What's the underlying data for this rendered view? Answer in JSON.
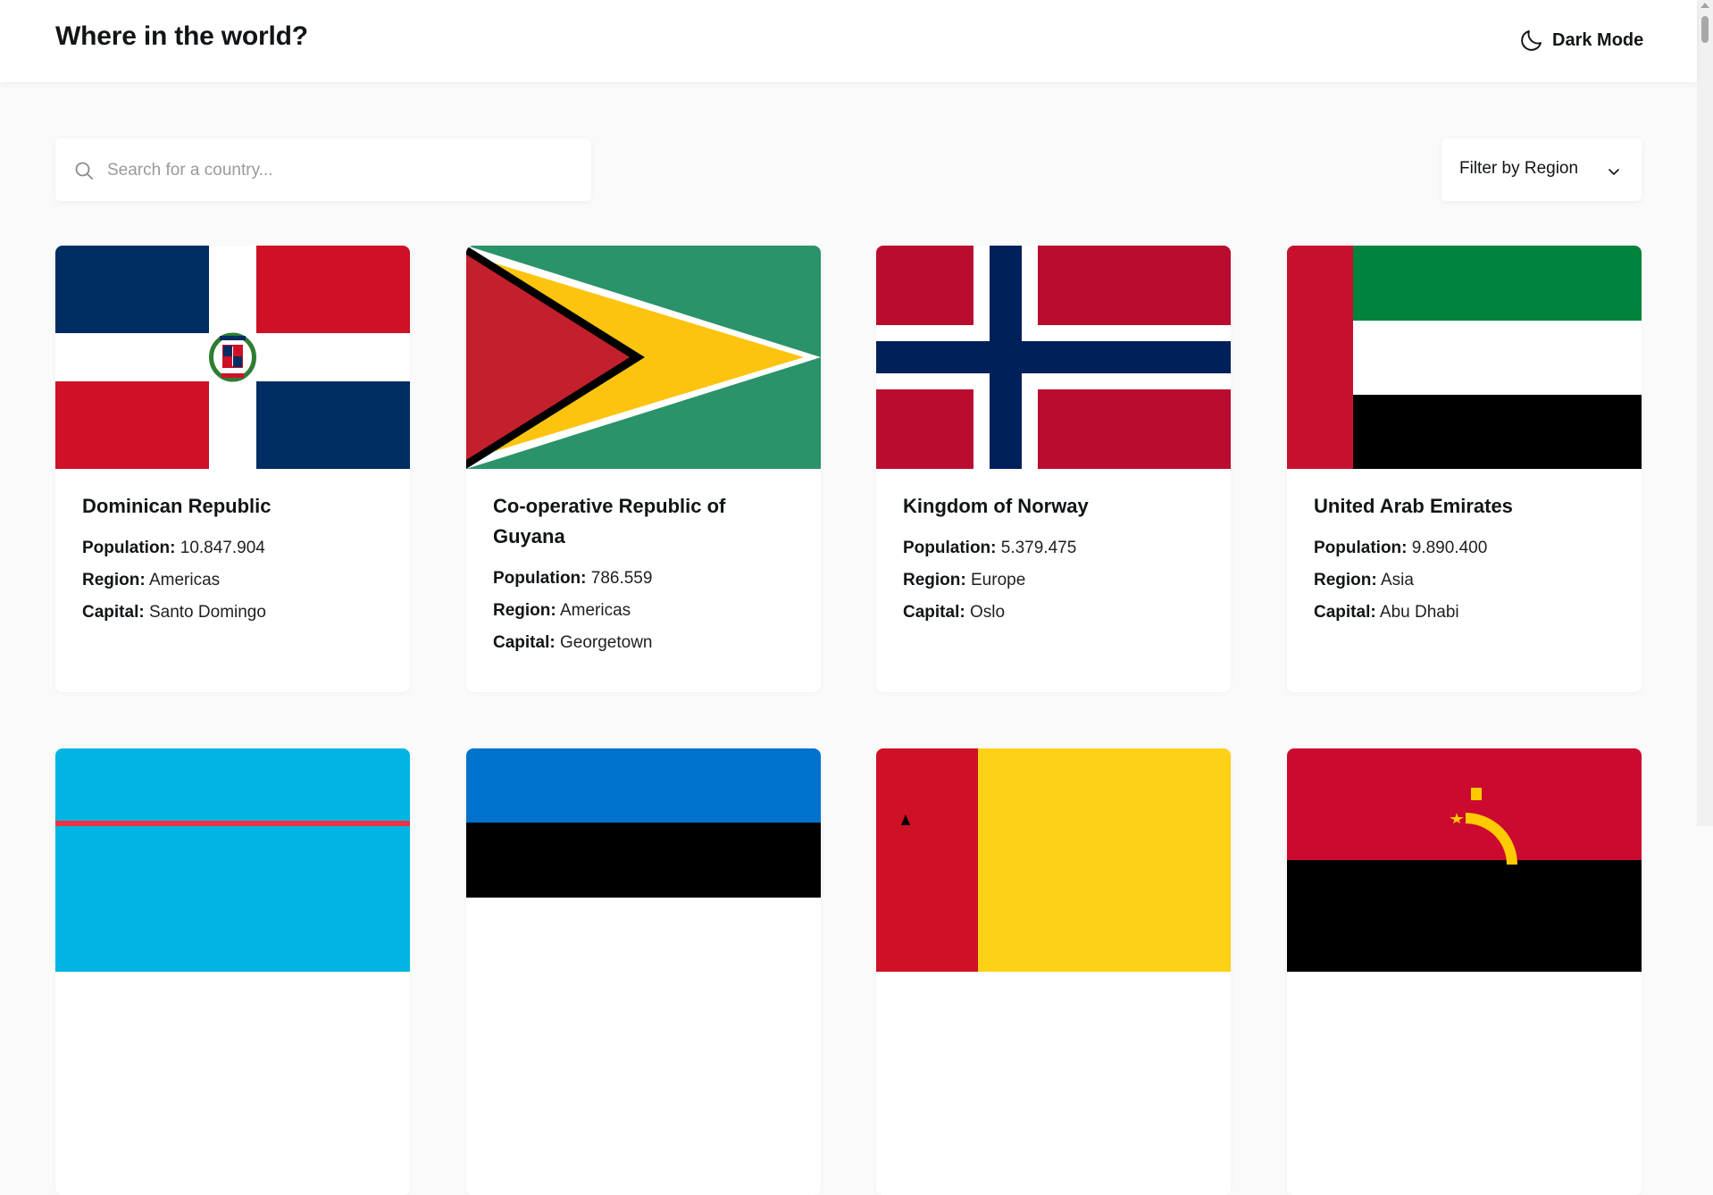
{
  "header": {
    "title": "Where in the world?",
    "theme_toggle_label": "Dark Mode"
  },
  "search": {
    "placeholder": "Search for a country...",
    "value": ""
  },
  "filter": {
    "label": "Filter by Region"
  },
  "labels": {
    "population": "Population:",
    "region": "Region:",
    "capital": "Capital:"
  },
  "countries": [
    {
      "name": "Dominican Republic",
      "population": "10.847.904",
      "region": "Americas",
      "capital": "Santo Domingo",
      "flag": "dominican-republic-flag"
    },
    {
      "name": "Co-operative Republic of Guyana",
      "population": "786.559",
      "region": "Americas",
      "capital": "Georgetown",
      "flag": "guyana-flag"
    },
    {
      "name": "Kingdom of Norway",
      "population": "5.379.475",
      "region": "Europe",
      "capital": "Oslo",
      "flag": "norway-flag"
    },
    {
      "name": "United Arab Emirates",
      "population": "9.890.400",
      "region": "Asia",
      "capital": "Abu Dhabi",
      "flag": "uae-flag"
    }
  ],
  "colors": {
    "background": "#fafafa",
    "card": "#ffffff",
    "text": "#111517"
  }
}
